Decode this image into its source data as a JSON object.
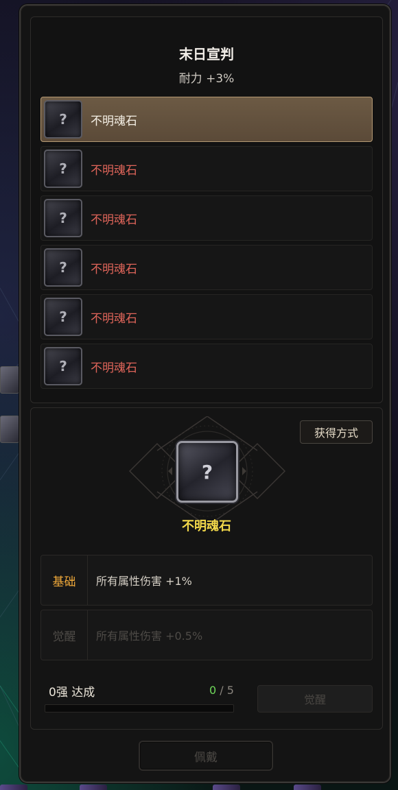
{
  "window": {
    "title": "末日宣判",
    "subtitle": "耐力 +3%"
  },
  "soul_stones": [
    {
      "label": "不明魂石",
      "icon_glyph": "?",
      "selected": true
    },
    {
      "label": "不明魂石",
      "icon_glyph": "?",
      "selected": false
    },
    {
      "label": "不明魂石",
      "icon_glyph": "?",
      "selected": false
    },
    {
      "label": "不明魂石",
      "icon_glyph": "?",
      "selected": false
    },
    {
      "label": "不明魂石",
      "icon_glyph": "?",
      "selected": false
    },
    {
      "label": "不明魂石",
      "icon_glyph": "?",
      "selected": false
    }
  ],
  "detail": {
    "acquire_label": "获得方式",
    "stone_glyph": "?",
    "stone_name": "不明魂石",
    "stats": {
      "base": {
        "tag": "基础",
        "text": "所有属性伤害 +1%"
      },
      "awaken": {
        "tag": "觉醒",
        "text": "所有属性伤害 +0.5%"
      }
    },
    "progress": {
      "label": "0强 达成",
      "current": "0",
      "separator": " / ",
      "max": "5",
      "fraction": 0
    },
    "awaken_button_label": "觉醒"
  },
  "equip_button_label": "佩戴",
  "colors": {
    "selected_row": "#6c5a44",
    "unowned_text": "#e0655a",
    "stone_name": "#f2d84a",
    "base_tag": "#f0a93a",
    "progress_current": "#6fd85a"
  },
  "icons": {
    "soul_stone": "unknown-soul-stone-icon"
  }
}
